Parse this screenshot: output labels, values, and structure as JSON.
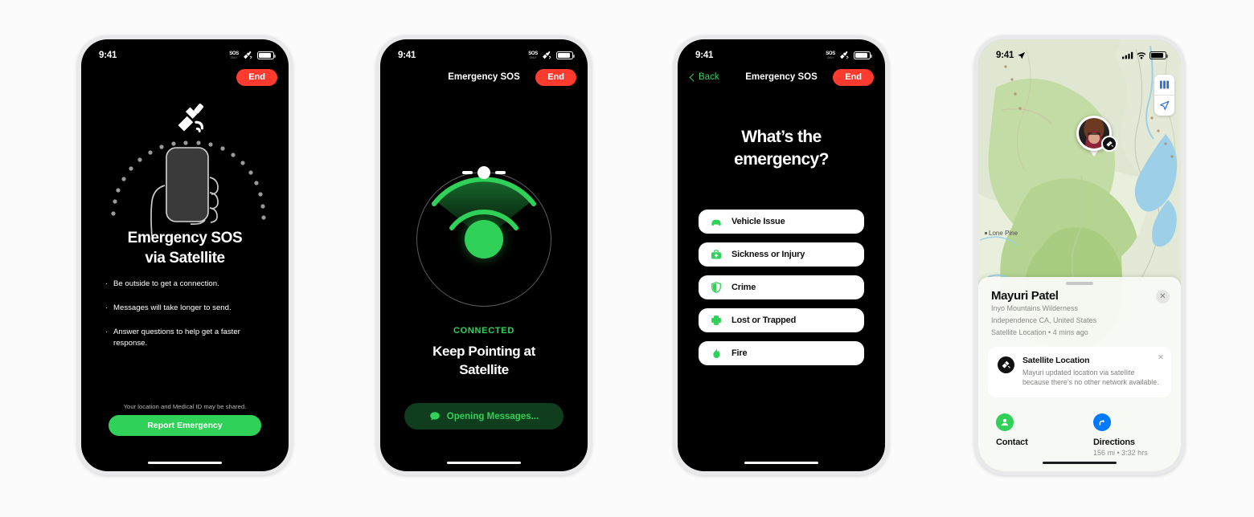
{
  "canvas": {
    "background": "#fbfbfb"
  },
  "colors": {
    "green": "#30d158",
    "red": "#ff3b30",
    "blue": "#007aff",
    "dark": "#000000"
  },
  "phones": [
    {
      "id": "phone-sos-intro",
      "status_bar": {
        "time": "9:41",
        "sos_primary": "SOS",
        "sos_secondary": "ONLY"
      },
      "nav": {
        "title": "",
        "end_label": "End"
      },
      "title_line1": "Emergency SOS",
      "title_line2": "via Satellite",
      "bullets": [
        "Be outside to get a connection.",
        "Messages will take longer to send.",
        "Answer questions to help get a faster response."
      ],
      "note": "Your location and Medical ID may be shared.",
      "cta": "Report Emergency"
    },
    {
      "id": "phone-connected",
      "status_bar": {
        "time": "9:41",
        "sos_primary": "SOS",
        "sos_secondary": "ONLY"
      },
      "nav": {
        "title": "Emergency SOS",
        "end_label": "End"
      },
      "status": "CONNECTED",
      "head_line1": "Keep Pointing at",
      "head_line2": "Satellite",
      "action": "Opening Messages..."
    },
    {
      "id": "phone-emergency-type",
      "status_bar": {
        "time": "9:41",
        "sos_primary": "SOS",
        "sos_secondary": "ONLY"
      },
      "nav": {
        "back_label": "Back",
        "title": "Emergency SOS",
        "end_label": "End"
      },
      "head_line1": "What’s the",
      "head_line2": "emergency?",
      "options": [
        {
          "label": "Vehicle Issue",
          "icon": "car-icon"
        },
        {
          "label": "Sickness or Injury",
          "icon": "medkit-icon"
        },
        {
          "label": "Crime",
          "icon": "shield-icon"
        },
        {
          "label": "Lost or Trapped",
          "icon": "cross-icon"
        },
        {
          "label": "Fire",
          "icon": "flame-icon"
        }
      ]
    },
    {
      "id": "phone-find-my-map",
      "status_bar": {
        "time": "9:41",
        "location_icon": "location-arrow-icon"
      },
      "map_label": "Lone Pine",
      "sheet": {
        "name": "Mayuri Patel",
        "sub1": "Inyo Mountains Wilderness",
        "sub2": "Independence CA, United States",
        "sub3": "Satellite Location • 4 mins ago",
        "close": "✕",
        "card": {
          "title": "Satellite Location",
          "body": "Mayuri updated location via satellite because there’s no other network available.",
          "close": "✕"
        },
        "actions": [
          {
            "label": "Contact",
            "sub": "",
            "icon": "person-icon",
            "color": "#30d158"
          },
          {
            "label": "Directions",
            "sub": "156 mi • 3:32 hrs",
            "icon": "directions-arrow-icon",
            "color": "#007aff"
          }
        ]
      }
    }
  ]
}
